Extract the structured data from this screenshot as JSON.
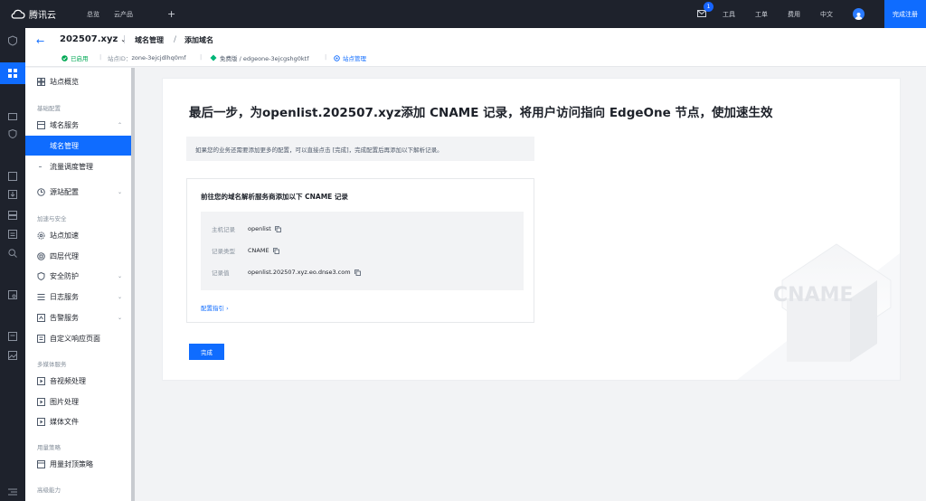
{
  "topbar": {
    "logo_text": "腾讯云",
    "links": [
      "总览",
      "云产品"
    ],
    "plus": "+",
    "mail_badge": "1",
    "right_items": [
      "工具",
      "工单",
      "费用",
      "中文"
    ],
    "register": "完成注册"
  },
  "header": {
    "site_name": "202507.xyz",
    "crumbs": [
      "域名管理",
      "添加域名"
    ],
    "status": "已启用",
    "zone_id_label": "站点ID：",
    "zone_id": "zone-3ejcjdlhq0mf",
    "plan": "免费版 / edgeone-3ejcgshg0ktf",
    "site_mgmt": "站点管理"
  },
  "sidebar": {
    "overview": "站点概览",
    "group_basic": "基础配置",
    "domain_service": "域名服务",
    "domain_mgmt": "域名管理",
    "traffic_mgmt": "流量调度管理",
    "origin_config": "源站配置",
    "group_accel": "加速与安全",
    "site_accel": "站点加速",
    "l4_proxy": "四层代理",
    "security": "安全防护",
    "log_service": "日志服务",
    "alarm_service": "告警服务",
    "custom_page": "自定义响应页面",
    "group_media": "多媒体服务",
    "av_process": "音视频处理",
    "image_process": "图片处理",
    "media_files": "媒体文件",
    "group_usage": "用量策略",
    "usage_cap": "用量封顶策略",
    "group_advanced": "高级能力"
  },
  "main": {
    "title": "最后一步，为openlist.202507.xyz添加 CNAME 记录，将用户访问指向 EdgeOne 节点，使加速生效",
    "hint": "如果您的业务还需要添加更多的配置，可以直接点击 [完成]，完成配置后再添加以下解析记录。",
    "inner_title": "前往您的域名解析服务商添加以下 CNAME 记录",
    "records": [
      {
        "label": "主机记录",
        "value": "openlist"
      },
      {
        "label": "记录类型",
        "value": "CNAME"
      },
      {
        "label": "记录值",
        "value": "openlist.202507.xyz.eo.dnse3.com"
      }
    ],
    "guide": "配置指引",
    "done": "完成",
    "illustration_text": "CNAME"
  },
  "colors": {
    "accent": "#0f6cff",
    "dark": "#1e222c",
    "status_green": "#00a854"
  }
}
